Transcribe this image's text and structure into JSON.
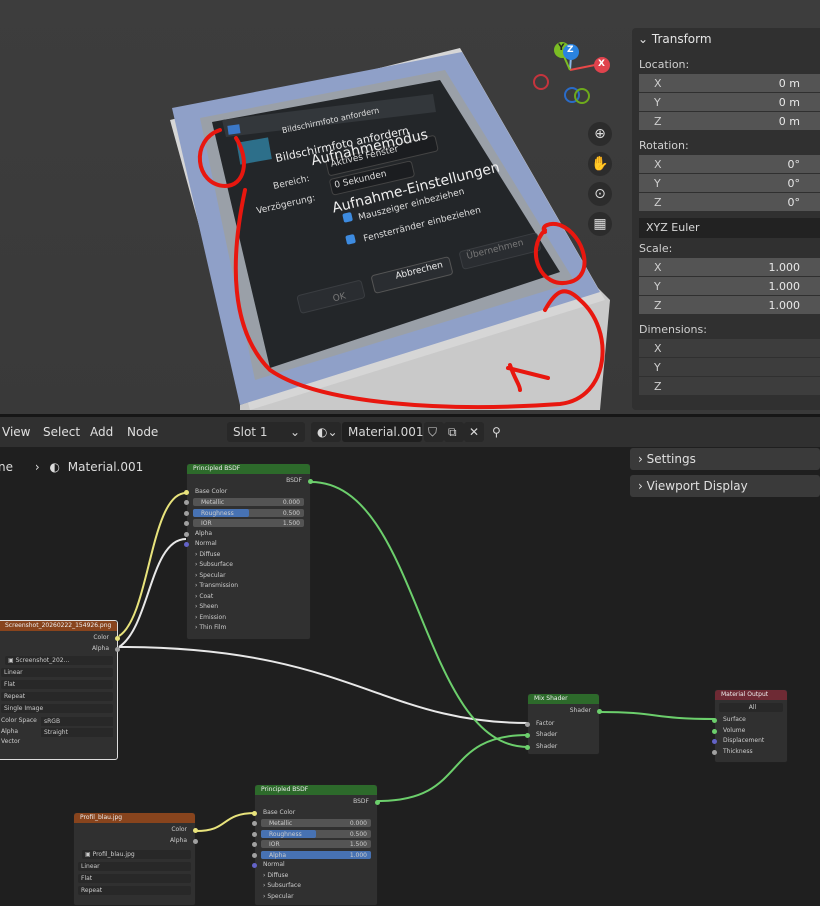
{
  "dialog": {
    "window_title": "Bildschirmfoto anfordern",
    "app_title": "Bildschirmfoto anfordern",
    "mode_heading": "Aufnahmemodus",
    "area_label": "Bereich:",
    "area_value": "Aktives Fenster",
    "delay_label": "Verzögerung:",
    "delay_value": "0 Sekunden",
    "settings_heading": "Aufnahme-Einstellungen",
    "cb1": "Mauszeiger einbeziehen",
    "cb2": "Fensterränder einbeziehen",
    "ok": "OK",
    "cancel": "Abbrechen",
    "take": "Übernehmen"
  },
  "gizmo": {
    "x": "X",
    "y": "Y",
    "z": "Z"
  },
  "icons": [
    "zoom-in-icon",
    "hand-icon",
    "camera-icon",
    "grid-icon"
  ],
  "npanel": {
    "title": "Transform",
    "location": "Location:",
    "rotation": "Rotation:",
    "scale": "Scale:",
    "dimensions": "Dimensions:",
    "loc": [
      {
        "k": "X",
        "v": "0 m"
      },
      {
        "k": "Y",
        "v": "0 m"
      },
      {
        "k": "Z",
        "v": "0 m"
      }
    ],
    "rot": [
      {
        "k": "X",
        "v": "0°"
      },
      {
        "k": "Y",
        "v": "0°"
      },
      {
        "k": "Z",
        "v": "0°"
      }
    ],
    "euler": "XYZ Euler",
    "scl": [
      {
        "k": "X",
        "v": "1.000"
      },
      {
        "k": "Y",
        "v": "1.000"
      },
      {
        "k": "Z",
        "v": "1.000"
      }
    ],
    "dim": [
      {
        "k": "X"
      },
      {
        "k": "Y"
      },
      {
        "k": "Z"
      }
    ]
  },
  "nodeheader": {
    "view": "View",
    "select": "Select",
    "add": "Add",
    "node": "Node",
    "slot": "Slot 1",
    "material": "Material.001"
  },
  "breadcrumb": {
    "prefix": "ne",
    "material": "Material.001"
  },
  "sidebar": {
    "settings": "Settings",
    "viewport_display": "Viewport Display"
  },
  "pbsdf1": {
    "title": "Principled BSDF",
    "out": "BSDF",
    "base": "Base Color",
    "metallic": "Metallic",
    "metallic_v": "0.000",
    "rough": "Roughness",
    "rough_v": "0.500",
    "ior": "IOR",
    "ior_v": "1.500",
    "alpha": "Alpha",
    "normal": "Normal",
    "groups": [
      "Diffuse",
      "Subsurface",
      "Specular",
      "Transmission",
      "Coat",
      "Sheen",
      "Emission",
      "Thin Film"
    ]
  },
  "img1": {
    "title": "Screenshot_20260222_154926.png",
    "color": "Color",
    "alpha": "Alpha",
    "file": "Screenshot_202...",
    "interp": "Linear",
    "proj": "Flat",
    "ext": "Repeat",
    "src": "Single Image",
    "cs_label": "Color Space",
    "cs": "sRGB",
    "alpha_label": "Alpha",
    "alpha_mode": "Straight",
    "vector": "Vector"
  },
  "mix": {
    "title": "Mix Shader",
    "out": "Shader",
    "factor": "Factor",
    "s1": "Shader",
    "s2": "Shader"
  },
  "out": {
    "title": "Material Output",
    "target": "All",
    "surface": "Surface",
    "volume": "Volume",
    "disp": "Displacement",
    "thick": "Thickness"
  },
  "img2": {
    "title": "Profil_blau.jpg",
    "color": "Color",
    "alpha": "Alpha",
    "file": "Profil_blau.jpg",
    "interp": "Linear",
    "proj": "Flat",
    "ext": "Repeat"
  },
  "pbsdf2": {
    "title": "Principled BSDF",
    "out": "BSDF",
    "base": "Base Color",
    "metallic": "Metallic",
    "metallic_v": "0.000",
    "rough": "Roughness",
    "rough_v": "0.500",
    "ior": "IOR",
    "ior_v": "1.500",
    "alpha": "Alpha",
    "alpha_v": "1.000",
    "normal": "Normal",
    "groups": [
      "Diffuse",
      "Subsurface",
      "Specular"
    ]
  }
}
